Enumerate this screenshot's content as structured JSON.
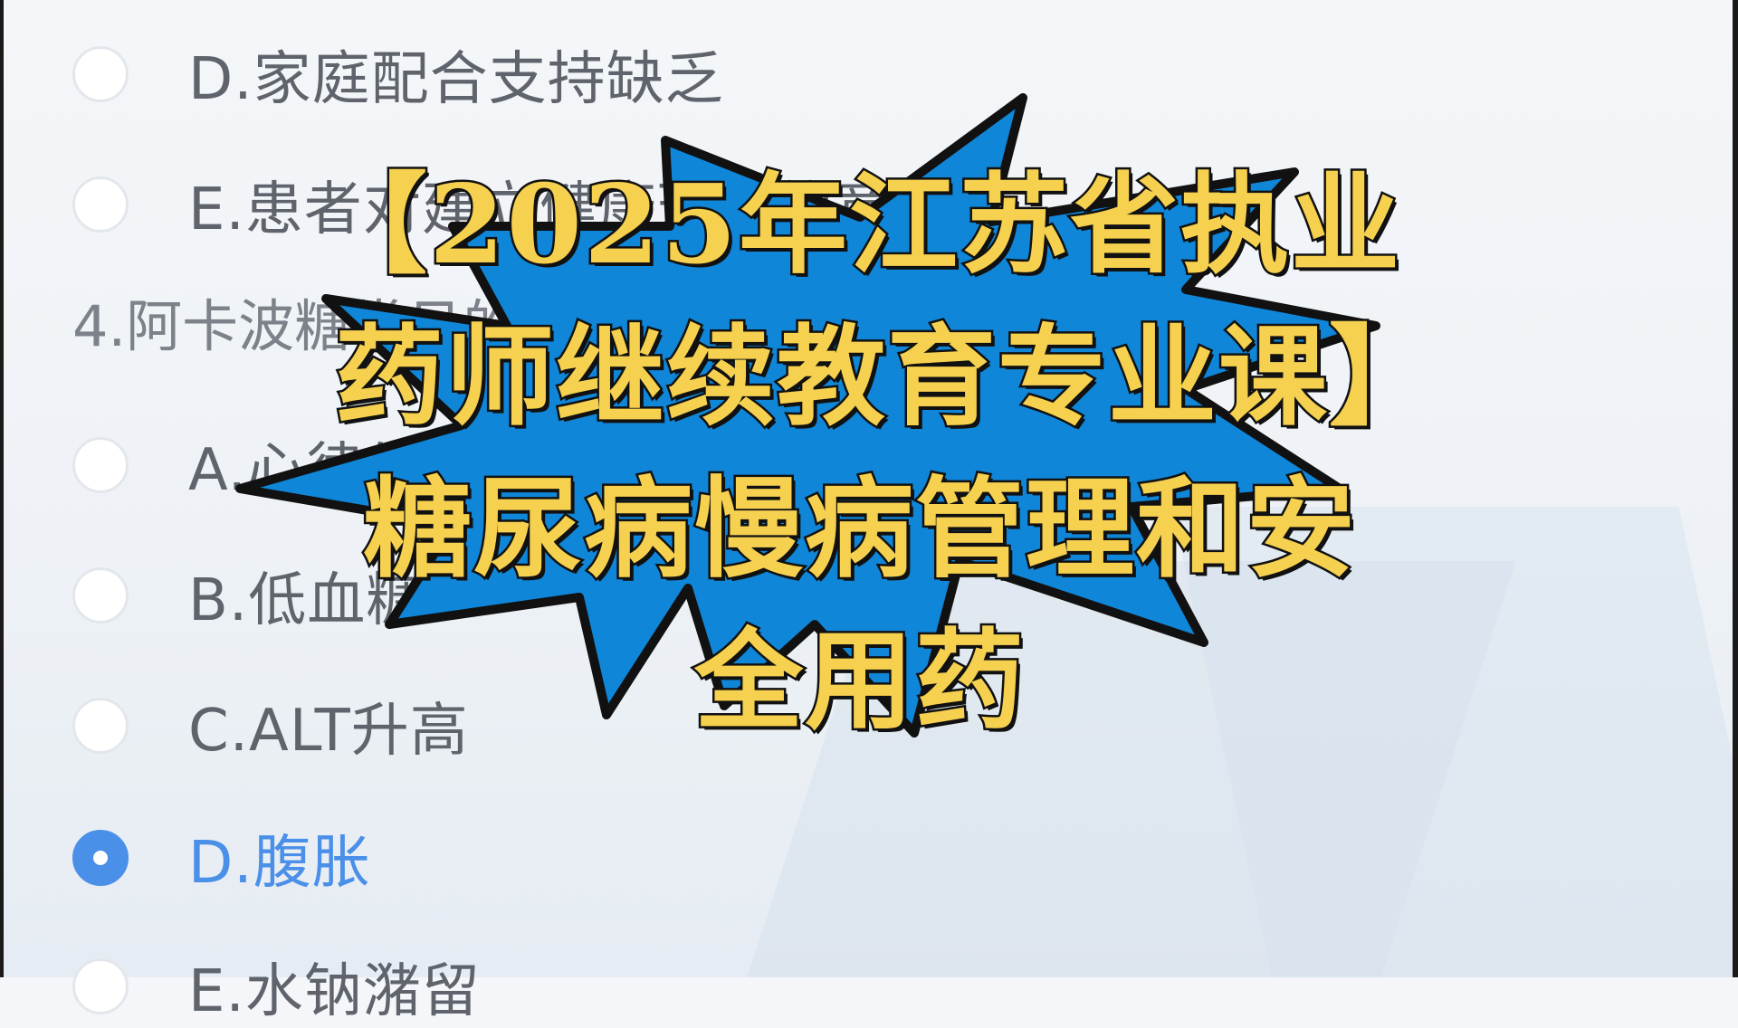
{
  "quiz": {
    "options_top": [
      {
        "label": "D.家庭配合支持缺乏",
        "selected": false
      },
      {
        "label": "E.患者对建立健康理性的意识",
        "selected": false
      }
    ],
    "question": "4.阿卡波糖常见的不良反应",
    "options_bottom": [
      {
        "label": "A.心律失常",
        "selected": false
      },
      {
        "label": "B.低血糖",
        "selected": false
      },
      {
        "label": "C.ALT升高",
        "selected": false
      },
      {
        "label": "D.腹胀",
        "selected": true
      },
      {
        "label": "E.水钠潴留",
        "selected": false
      }
    ]
  },
  "overlay": {
    "title": "【2025年江苏省执业药师继续教育专业课】糖尿病慢病管理和安全用药",
    "burst_color": "#0f86d8",
    "title_color": "#f6d04f"
  }
}
